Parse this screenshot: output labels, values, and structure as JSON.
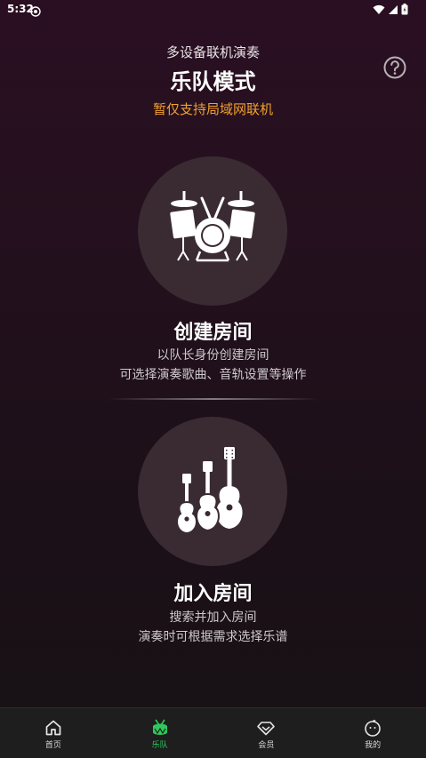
{
  "status_bar": {
    "time": "5:32"
  },
  "header": {
    "subtitle": "多设备联机演奏",
    "title": "乐队模式",
    "note": "暂仅支持局域网联机"
  },
  "create_room": {
    "title": "创建房间",
    "line1": "以队长身份创建房间",
    "line2": "可选择演奏歌曲、音轨设置等操作",
    "icon": "drum-kit-icon"
  },
  "join_room": {
    "title": "加入房间",
    "line1": "搜索并加入房间",
    "line2": "演奏时可根据需求选择乐谱",
    "icon": "guitars-icon"
  },
  "tabbar": {
    "items": [
      {
        "label": "首页",
        "icon": "home-icon"
      },
      {
        "label": "乐队",
        "icon": "drum-icon",
        "active": true
      },
      {
        "label": "会员",
        "icon": "diamond-icon"
      },
      {
        "label": "我的",
        "icon": "face-icon"
      }
    ],
    "active_color": "#2fc85c"
  },
  "colors": {
    "accent": "#f0a12e",
    "circle": "#3a2b33"
  }
}
